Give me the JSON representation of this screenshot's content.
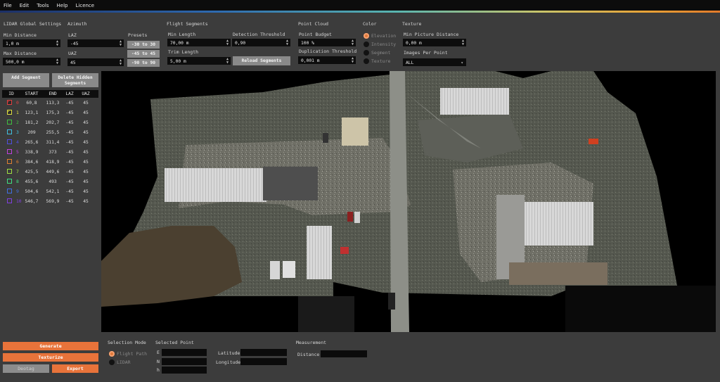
{
  "menu": {
    "file": "File",
    "edit": "Edit",
    "tools": "Tools",
    "help": "Help",
    "licence": "Licence"
  },
  "lidar": {
    "title": "LIDAR Global Settings",
    "min_label": "Min Distance",
    "min_value": "1,0 m",
    "max_label": "Max Distance",
    "max_value": "500,0 m"
  },
  "azimuth": {
    "title": "Azimuth",
    "laz_label": "LAZ",
    "laz_value": "-45",
    "uaz_label": "UAZ",
    "uaz_value": "45",
    "presets_label": "Presets",
    "p1": "-30 to 30",
    "p2": "-45 to 45",
    "p3": "-90 to 90"
  },
  "flight": {
    "title": "Flight Segments",
    "minlen_label": "Min Length",
    "minlen_value": "70,00 m",
    "thresh_label": "Detection Threshold",
    "thresh_value": "0,90",
    "trim_label": "Trim Length",
    "trim_value": "5,00 m",
    "reload": "Reload Segments"
  },
  "cloud": {
    "title": "Point Cloud",
    "budget_label": "Point Budget",
    "budget_value": "100 %",
    "dup_label": "Duplication Threshold",
    "dup_value": "0,001 m"
  },
  "color": {
    "title": "Color",
    "o1": "Elevation",
    "o2": "Intensity",
    "o3": "Segment",
    "o4": "Texture"
  },
  "texture": {
    "title": "Texture",
    "minpic_label": "Min Picture Distance",
    "minpic_value": "0,00 m",
    "ipp_label": "Images Per Point",
    "ipp_value": "ALL"
  },
  "segments": {
    "add": "Add Segment",
    "delete": "Delete Hidden Segments",
    "headers": [
      "ID",
      "START",
      "END",
      "LAZ",
      "UAZ"
    ],
    "rows": [
      {
        "id": "0",
        "start": "60,8",
        "end": "113,3",
        "laz": "-45",
        "uaz": "45",
        "color": "#e04040",
        "checked": true
      },
      {
        "id": "1",
        "start": "123,1",
        "end": "175,3",
        "laz": "-45",
        "uaz": "45",
        "color": "#e0e040",
        "checked": true
      },
      {
        "id": "2",
        "start": "181,2",
        "end": "202,7",
        "laz": "-45",
        "uaz": "45",
        "color": "#40c040",
        "checked": false
      },
      {
        "id": "3",
        "start": "209",
        "end": "255,5",
        "laz": "-45",
        "uaz": "45",
        "color": "#40c0e0",
        "checked": false
      },
      {
        "id": "4",
        "start": "265,6",
        "end": "311,4",
        "laz": "-45",
        "uaz": "45",
        "color": "#5050e0",
        "checked": false
      },
      {
        "id": "5",
        "start": "338,9",
        "end": "373",
        "laz": "-45",
        "uaz": "45",
        "color": "#c040e0",
        "checked": false
      },
      {
        "id": "6",
        "start": "384,6",
        "end": "418,9",
        "laz": "-45",
        "uaz": "45",
        "color": "#e08030",
        "checked": false
      },
      {
        "id": "7",
        "start": "425,5",
        "end": "449,6",
        "laz": "-45",
        "uaz": "45",
        "color": "#a0e040",
        "checked": false
      },
      {
        "id": "8",
        "start": "455,6",
        "end": "493",
        "laz": "-45",
        "uaz": "45",
        "color": "#40e080",
        "checked": false
      },
      {
        "id": "9",
        "start": "504,6",
        "end": "542,1",
        "laz": "-45",
        "uaz": "45",
        "color": "#4070e0",
        "checked": false
      },
      {
        "id": "10",
        "start": "546,7",
        "end": "569,9",
        "laz": "-45",
        "uaz": "45",
        "color": "#8040e0",
        "checked": false
      }
    ]
  },
  "actions": {
    "generate": "Generate",
    "texturize": "Texturize",
    "deotag": "Deotag",
    "export": "Export"
  },
  "selection": {
    "title": "Selection Mode",
    "o1": "Flight Path",
    "o2": "LIDAR"
  },
  "point": {
    "title": "Selected Point",
    "e": "E",
    "n": "N",
    "h": "h",
    "lat": "Latitude",
    "lon": "Longitude"
  },
  "measure": {
    "title": "Measurement",
    "dist": "Distance"
  }
}
